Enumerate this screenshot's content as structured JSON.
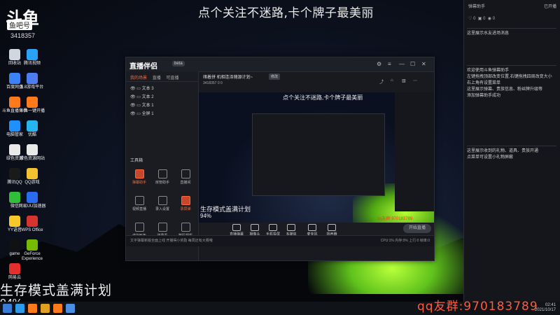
{
  "desktop": {
    "banner": "点个关注不迷路,卡个牌子最美丽",
    "logo": {
      "text": "斗鱼",
      "sub": "鱼吧号",
      "id": "3418357"
    },
    "icons": [
      {
        "label": "回收站",
        "color": "#cfd8e0"
      },
      {
        "label": "腾讯视频",
        "color": "#29a3f5"
      },
      {
        "label": "百度网盘",
        "color": "#3b82f6"
      },
      {
        "label": "5.8游戏平台",
        "color": "#4d7df0"
      },
      {
        "label": "斗鱼直播伴侣",
        "color": "#ff7a1a"
      },
      {
        "label": "斗鱼一键开播",
        "color": "#ff7a1a"
      },
      {
        "label": "电脑管家",
        "color": "#1e90ff"
      },
      {
        "label": "优酷",
        "color": "#27b5f0"
      },
      {
        "label": "绿色资源",
        "color": "#e9e9e9"
      },
      {
        "label": "绿色资源网站",
        "color": "#e9e9e9"
      },
      {
        "label": "腾讯QQ",
        "color": "#1a1a1a"
      },
      {
        "label": "QQ游戏",
        "color": "#f2c230"
      },
      {
        "label": "微信",
        "color": "#2fbf3b"
      },
      {
        "label": "网易UU加速器",
        "color": "#2a6cf0"
      },
      {
        "label": "YY语音",
        "color": "#f7c82a"
      },
      {
        "label": "WPS Office",
        "color": "#d6342f"
      },
      {
        "label": "game",
        "color": "#111111"
      },
      {
        "label": "GeForce Experience",
        "color": "#76b900"
      },
      {
        "label": "网易云",
        "color": "#e52e2e"
      }
    ],
    "overlay_title": "生存模式盖满计划",
    "overlay_pct": "94%",
    "qq_text": "qq友群:970183789",
    "clock_time": "02:41",
    "clock_date": "2021/10/17"
  },
  "right_panel": {
    "header": "弹幕助手",
    "header_right": "已开播",
    "counters": [
      "0",
      "0",
      "0"
    ],
    "box1": "这里展示水友进场消息",
    "box2": [
      "欢迎使用斗鱼弹幕助手",
      "左键拖拽顶部改变位置,右键拖拽四周改变大小",
      "右上角有设置菜单",
      "这里展示弹幕、贵族信息、粉丝牌升级等",
      "添加弹幕助手成功"
    ],
    "box3": [
      "这里展示收到的礼物、道具、贵族开通",
      "点菜单可设置小礼物屏蔽"
    ]
  },
  "app": {
    "name": "直播伴侣",
    "version": "beta",
    "tabs": [
      "我的场景",
      "直播",
      "可直播"
    ],
    "scenes": [
      "文本 3",
      "文本 2",
      "文本 1",
      "全屏 1"
    ],
    "tools_title": "工具箱",
    "tools": [
      {
        "label": "弹幕助手",
        "active": true
      },
      {
        "label": "房管助手",
        "active": false
      },
      {
        "label": "直播间",
        "active": false
      },
      {
        "label": "视频直播",
        "active": false
      },
      {
        "label": "录入设置",
        "active": false
      },
      {
        "label": "录屏弹",
        "active": true
      },
      {
        "label": "虚拟形象",
        "active": false
      },
      {
        "label": "弹幕看",
        "active": false
      },
      {
        "label": "数码相机",
        "active": false
      }
    ],
    "room_title": "绪着拼 机相连泽随源计划~",
    "room_badge": "修改",
    "room_meta": "3418357  0  0",
    "status_text": "文字弹幕新版全面上线 开播得小奖励 每周还有大赛哦",
    "stats": "CPU:1%  内存:0%  上行:0  帧率:0",
    "preview": {
      "banner": "点个关注不迷路,卡个牌子最美丽",
      "title": "生存模式盖满计划",
      "pct": "94%",
      "red": "qq友群:970183789"
    },
    "bottom_items": [
      "直播弹幕",
      "摄像头",
      "手机投屏",
      "多媒体",
      "麦克风",
      "扬声器"
    ],
    "go_live": "开始直播"
  }
}
